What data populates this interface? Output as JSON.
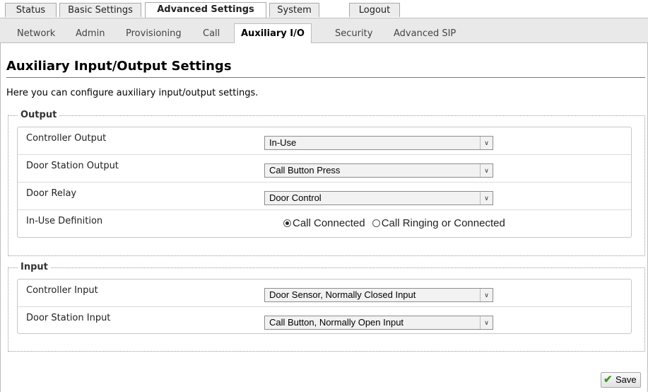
{
  "top_tabs": [
    {
      "label": "Status"
    },
    {
      "label": "Basic Settings"
    },
    {
      "label": "Advanced Settings"
    },
    {
      "label": "System"
    },
    {
      "label": "Logout"
    }
  ],
  "sub_tabs": [
    {
      "label": "Network"
    },
    {
      "label": "Admin"
    },
    {
      "label": "Provisioning"
    },
    {
      "label": "Call"
    },
    {
      "label": "Auxiliary I/O"
    },
    {
      "label": "Security"
    },
    {
      "label": "Advanced SIP"
    }
  ],
  "page": {
    "title": "Auxiliary Input/Output Settings",
    "intro": "Here you can configure auxiliary input/output settings."
  },
  "output": {
    "legend": "Output",
    "rows": [
      {
        "label": "Controller Output",
        "value": "In-Use"
      },
      {
        "label": "Door Station Output",
        "value": "Call Button Press"
      },
      {
        "label": "Door Relay",
        "value": "Door Control"
      }
    ],
    "in_use": {
      "label": "In-Use Definition",
      "options": [
        {
          "label": "Call Connected",
          "checked": true
        },
        {
          "label": "Call Ringing or Connected",
          "checked": false
        }
      ]
    }
  },
  "input": {
    "legend": "Input",
    "rows": [
      {
        "label": "Controller Input",
        "value": "Door Sensor, Normally Closed Input"
      },
      {
        "label": "Door Station Input",
        "value": "Call Button, Normally Open Input"
      }
    ]
  },
  "save_label": "Save",
  "colors": {
    "save_check": "#3a9a1f",
    "sub_bar": "#e9e9e9"
  }
}
